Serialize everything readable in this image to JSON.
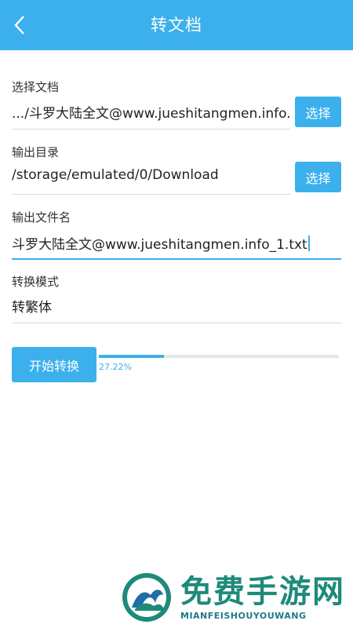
{
  "appbar": {
    "title": "转文档"
  },
  "select_doc": {
    "label": "选择文档",
    "value": ".../斗罗大陆全文@www.jueshitangmen.info.txt",
    "button": "选择"
  },
  "output_dir": {
    "label": "输出目录",
    "value": "/storage/emulated/0/Download",
    "button": "选择"
  },
  "output_name": {
    "label": "输出文件名",
    "value": "斗罗大陆全文@www.jueshitangmen.info_1.txt"
  },
  "mode": {
    "label": "转换模式",
    "value": "转繁体"
  },
  "convert": {
    "button": "开始转换",
    "progress_text": "27.22%",
    "progress_fraction": 0.2722
  },
  "watermark": {
    "title": "免费手游网",
    "subtitle": "MIANFEISHOUYOUWANG"
  },
  "colors": {
    "accent": "#3bb0ec",
    "watermark": "#1e8a7a"
  },
  "icons": {
    "back": "chevron-left-icon",
    "logo": "watermark-logo-icon"
  }
}
